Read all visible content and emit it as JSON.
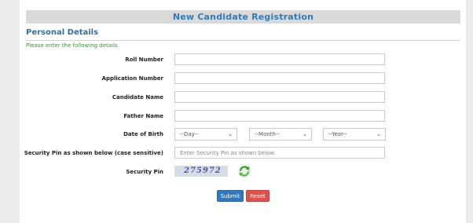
{
  "header": {
    "title": "New Candidate Registration"
  },
  "section": {
    "title": "Personal Details",
    "hint": "Please enter the following details."
  },
  "form": {
    "roll_number_label": "Roll Number",
    "application_number_label": "Application Number",
    "candidate_name_label": "Candidate Name",
    "father_name_label": "Father Name",
    "dob_label": "Date of Birth",
    "dob_day": "--Day--",
    "dob_month": "--Month--",
    "dob_year": "--Year--",
    "security_pin_input_label": "Security Pin as shown below (case sensitive)",
    "security_pin_placeholder": "Enter Security Pin as shown below",
    "security_pin_label": "Security Pin",
    "captcha_text": "275972",
    "submit_label": "Submit",
    "reset_label": "Reset"
  },
  "colors": {
    "accent": "#2f7bbd",
    "hint": "#3e8e3e",
    "submit": "#3577b9",
    "reset": "#d9534f"
  },
  "icons": {
    "refresh": "refresh-icon",
    "caret": "chevron-down-icon"
  }
}
